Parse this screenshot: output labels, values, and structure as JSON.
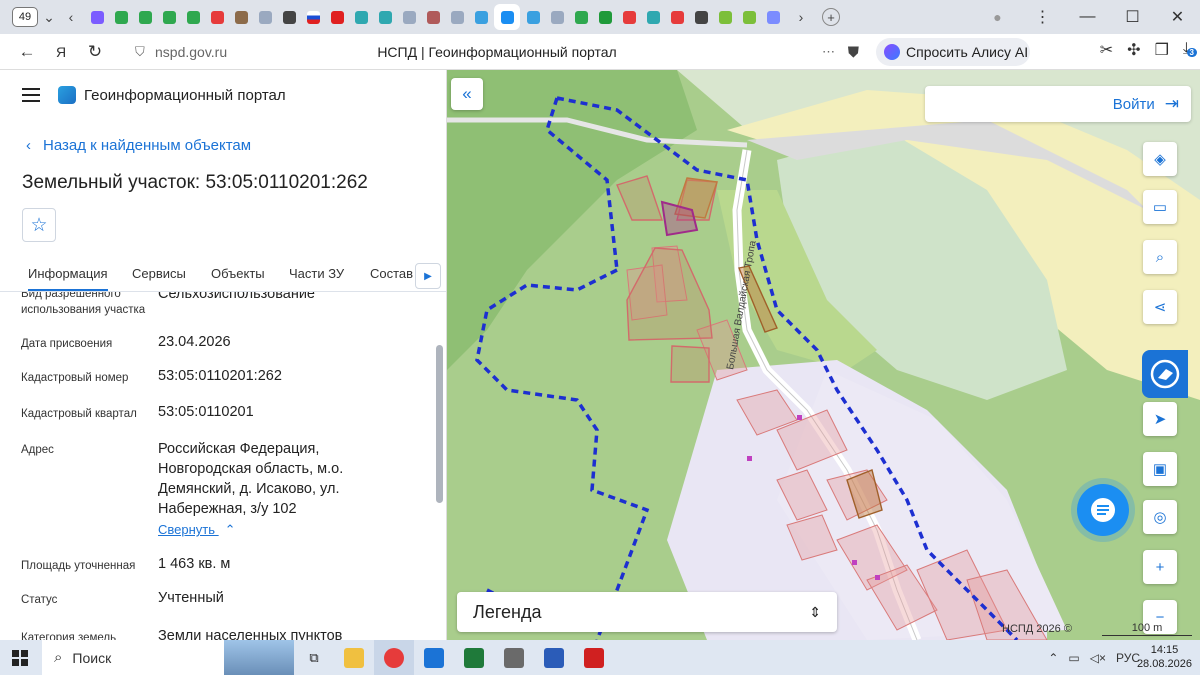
{
  "browser": {
    "tab_count": "49",
    "url": "nspd.gov.ru",
    "page_title": "НСПД | Геоинформационный портал",
    "alice_label": "Спросить Алису AI",
    "downloads_badge": "3"
  },
  "app": {
    "title": "Геоинформационный портал",
    "back_link": "Назад к найденным объектам",
    "object_title": "Земельный участок: 53:05:0110201:262",
    "tabs": [
      "Информация",
      "Сервисы",
      "Объекты",
      "Части ЗУ",
      "Состав"
    ],
    "fields": [
      {
        "label": "Вид разрешенного использования участка",
        "value": "Сельхозиспользование"
      },
      {
        "label": "Дата присвоения",
        "value": "23.04.2026"
      },
      {
        "label": "Кадастровый номер",
        "value": "53:05:0110201:262"
      },
      {
        "label": "Кадастровый квартал",
        "value": "53:05:0110201"
      },
      {
        "label": "Адрес",
        "value": "Российская Федерация, Новгородская область, м.о. Демянский, д. Исаково, ул. Набережная, з/у 102"
      },
      {
        "label": "Площадь уточненная",
        "value": "1 463 кв. м"
      },
      {
        "label": "Статус",
        "value": "Учтенный"
      },
      {
        "label": "Категория земель",
        "value": "Земли населенных пунктов"
      }
    ],
    "collapse_label": "Свернуть"
  },
  "map": {
    "login_label": "Войти",
    "street_label": "Большая Валдайская Тропа",
    "legend_label": "Легенда",
    "attribution": "НСПД 2026 ©",
    "scale_label": "100 m"
  },
  "taskbar": {
    "search_label": "Поиск",
    "lang": "РУС",
    "time": "14:15",
    "date": "28.08.2026"
  }
}
